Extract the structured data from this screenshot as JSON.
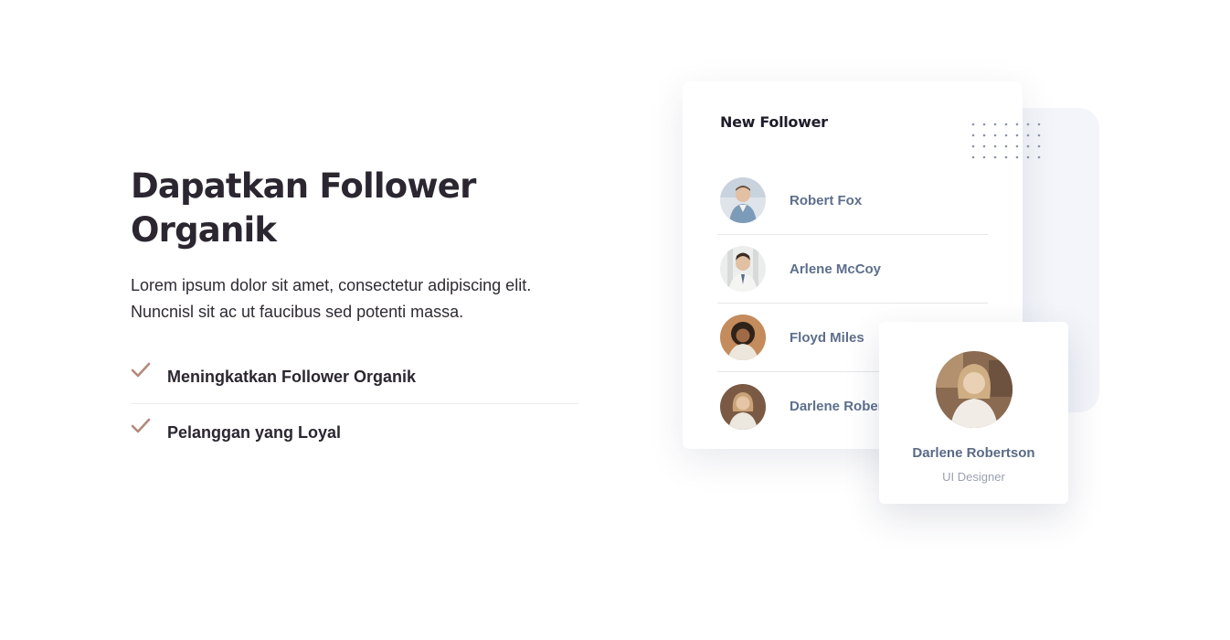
{
  "hero": {
    "heading_line1": "Dapatkan Follower",
    "heading_line2": "Organik",
    "lead_line1": "Lorem ipsum dolor sit amet, consectetur adipiscing elit.",
    "lead_line2": "Nuncnisl sit ac ut faucibus sed potenti massa."
  },
  "features": [
    {
      "label": "Meningkatkan Follower Organik",
      "icon": "check-icon"
    },
    {
      "label": "Pelanggan yang Loyal",
      "icon": "check-icon"
    }
  ],
  "follower_card": {
    "title": "New Follower",
    "items": [
      {
        "name": "Robert Fox"
      },
      {
        "name": "Arlene McCoy"
      },
      {
        "name": "Floyd Miles"
      },
      {
        "name": "Darlene Robertson"
      }
    ]
  },
  "profile_card": {
    "name": "Darlene Robertson",
    "role": "UI Designer"
  },
  "colors": {
    "heading": "#2b2630",
    "check": "#b38a7a",
    "name": "#5d6f8c",
    "accent_bg": "#f3f5fa"
  }
}
